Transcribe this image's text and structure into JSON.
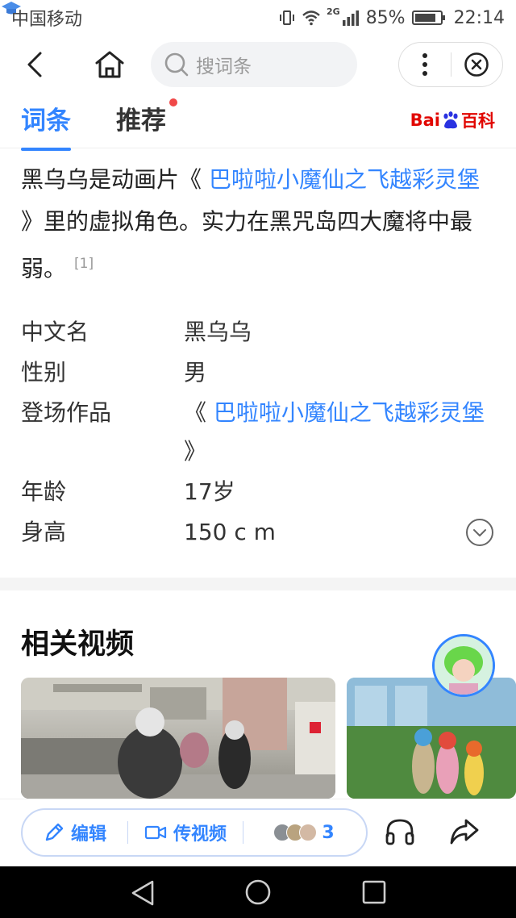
{
  "status_bar": {
    "carrier": "中国移动",
    "network_type": "2G",
    "battery_text": "85%",
    "battery_level": 0.85,
    "time": "22:14"
  },
  "nav": {
    "search_placeholder": "搜词条"
  },
  "tabs": [
    {
      "label": "词条",
      "active": true
    },
    {
      "label": "推荐",
      "active": false,
      "has_dot": true
    }
  ],
  "logo": {
    "part1": "Bai",
    "part2": "百科"
  },
  "intro": {
    "text_before": "黑乌乌是动画片",
    "open_quote": "《",
    "link_text": "巴啦啦小魔仙之飞越彩灵堡",
    "close_quote": "》",
    "text_after": "里的虚拟角色。实力在黑咒岛四大魔将中最弱。",
    "ref": "[1]"
  },
  "infobox": [
    {
      "key": "中文名",
      "value": "黑乌乌"
    },
    {
      "key": "性别",
      "value": "男"
    },
    {
      "key": "登场作品",
      "value_prefix": "《",
      "value_link": "巴啦啦小魔仙之飞越彩灵堡",
      "value_suffix": "》"
    },
    {
      "key": "年龄",
      "value": "17岁"
    },
    {
      "key": "身高",
      "value": "150 c m"
    }
  ],
  "videos": {
    "title": "相关视频"
  },
  "bottom_bar": {
    "edit_label": "编辑",
    "upload_label": "传视频",
    "contributors_count": "3"
  },
  "colors": {
    "accent": "#3385ff",
    "baike_red": "#e10601",
    "dot_red": "#f04848"
  }
}
